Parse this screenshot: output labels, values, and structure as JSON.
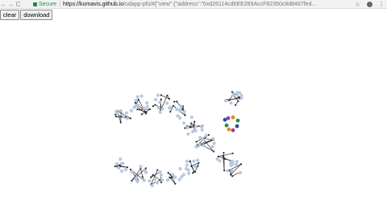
{
  "browser": {
    "back_glyph": "←",
    "forward_glyph": "→",
    "reload_glyph": "C",
    "secure_label": "Secure",
    "separator": "|",
    "url_host": "https://kumavis.github.io",
    "url_path": "/udapp-pfs/#{\"view\":{\"address\":\"0xd26114cd6EE289AccF82350c8d8487fed...",
    "star_glyph": "☆",
    "menu_glyph": "⋮"
  },
  "toolbar": {
    "clear_label": "clear",
    "download_label": "download"
  },
  "graph": {
    "node_color": "#b8c9e0",
    "link_color": "#2b2b2b",
    "accent_nodes": [
      "#2a4d9e",
      "#2e8b3e",
      "#e08a1e",
      "#9b3fa0"
    ]
  }
}
